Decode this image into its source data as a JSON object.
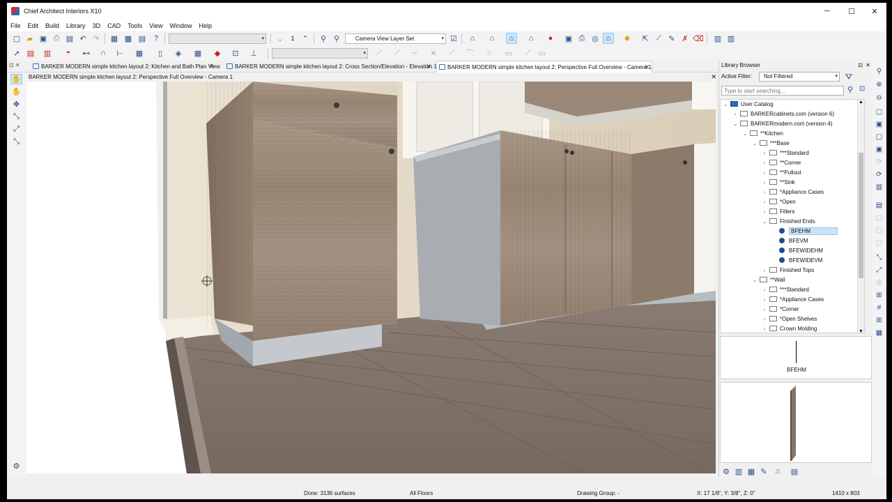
{
  "window": {
    "title": "Chief Architect Interiors X10",
    "minimize": "─",
    "maximize": "☐",
    "close": "✕"
  },
  "menu": [
    "File",
    "Edit",
    "Build",
    "Library",
    "3D",
    "CAD",
    "Tools",
    "View",
    "Window",
    "Help"
  ],
  "toolbar": {
    "layer_set": "Camera View Layer Set",
    "scale_value": "1"
  },
  "tabs": [
    {
      "label": "BARKER MODERN simple kitchen layout 2: Kitchen and Bath Plan View",
      "close": "✕"
    },
    {
      "label": "BARKER MODERN simple kitchen layout 2: Cross Section/Elevation - Elevation 1",
      "close": "✕"
    },
    {
      "label": "BARKER MODERN simple kitchen layout 2: Perspective Full Overview - Camera 1",
      "close": "✕"
    }
  ],
  "camera_bar": {
    "title": "BARKER MODERN simple kitchen layout 2: Perspective Full Overview - Camera 1",
    "close": "✕"
  },
  "library": {
    "header": "Library Browser",
    "pin": "⊡",
    "close": "✕",
    "filter_label": "Active Filter:",
    "filter_value": "Not Filtered",
    "search_placeholder": "Type to start searching...",
    "tree": [
      {
        "label": "User Catalog",
        "level": 0,
        "caret": "⌄",
        "icon": "folder-blue"
      },
      {
        "label": "BARKERcabinets.com (version 6)",
        "level": 1,
        "caret": "›",
        "icon": "folder"
      },
      {
        "label": "BARKERmodern.com (version 4)",
        "level": 1,
        "caret": "⌄",
        "icon": "folder"
      },
      {
        "label": "**Kitchen",
        "level": 2,
        "caret": "⌄",
        "icon": "folder"
      },
      {
        "label": "***Base",
        "level": 3,
        "caret": "⌄",
        "icon": "folder"
      },
      {
        "label": "***Standard",
        "level": 4,
        "caret": "›",
        "icon": "folder"
      },
      {
        "label": "**Corner",
        "level": 4,
        "caret": "›",
        "icon": "folder"
      },
      {
        "label": "**Pullout",
        "level": 4,
        "caret": "›",
        "icon": "folder"
      },
      {
        "label": "**Sink",
        "level": 4,
        "caret": "›",
        "icon": "folder"
      },
      {
        "label": "*Appliance Cases",
        "level": 4,
        "caret": "›",
        "icon": "folder"
      },
      {
        "label": "*Open",
        "level": 4,
        "caret": "›",
        "icon": "folder"
      },
      {
        "label": "Fillers",
        "level": 4,
        "caret": "›",
        "icon": "folder"
      },
      {
        "label": "Finished Ends",
        "level": 4,
        "caret": "⌄",
        "icon": "folder"
      },
      {
        "label": "BFEHM",
        "level": 5,
        "caret": "",
        "icon": "item",
        "selected": true
      },
      {
        "label": "BFEVM",
        "level": 5,
        "caret": "",
        "icon": "item"
      },
      {
        "label": "BFEWIDEHM",
        "level": 5,
        "caret": "",
        "icon": "item"
      },
      {
        "label": "BFEWIDEVM",
        "level": 5,
        "caret": "",
        "icon": "item"
      },
      {
        "label": "Finished Tops",
        "level": 4,
        "caret": "›",
        "icon": "folder"
      },
      {
        "label": "**Wall",
        "level": 3,
        "caret": "⌄",
        "icon": "folder"
      },
      {
        "label": "***Standard",
        "level": 4,
        "caret": "›",
        "icon": "folder"
      },
      {
        "label": "*Appliance Cases",
        "level": 4,
        "caret": "›",
        "icon": "folder"
      },
      {
        "label": "*Corner",
        "level": 4,
        "caret": "›",
        "icon": "folder"
      },
      {
        "label": "*Open Shelves",
        "level": 4,
        "caret": "›",
        "icon": "folder"
      },
      {
        "label": "Crown Molding",
        "level": 4,
        "caret": "›",
        "icon": "folder"
      }
    ],
    "preview_label": "BFEHM"
  },
  "status": {
    "done": "Done:  3136 surfaces",
    "floors": "All Floors",
    "drawing_group": "Drawing Group: -",
    "coords": "X: 17 1/8\", Y: 3/8\", Z: 0\"",
    "size": "1410 x 803"
  },
  "colors": {
    "selection": "#cce4f7",
    "accent": "#2a4d8f",
    "cabinet_wood": "#9b8a7d",
    "floor": "#7e7068"
  }
}
